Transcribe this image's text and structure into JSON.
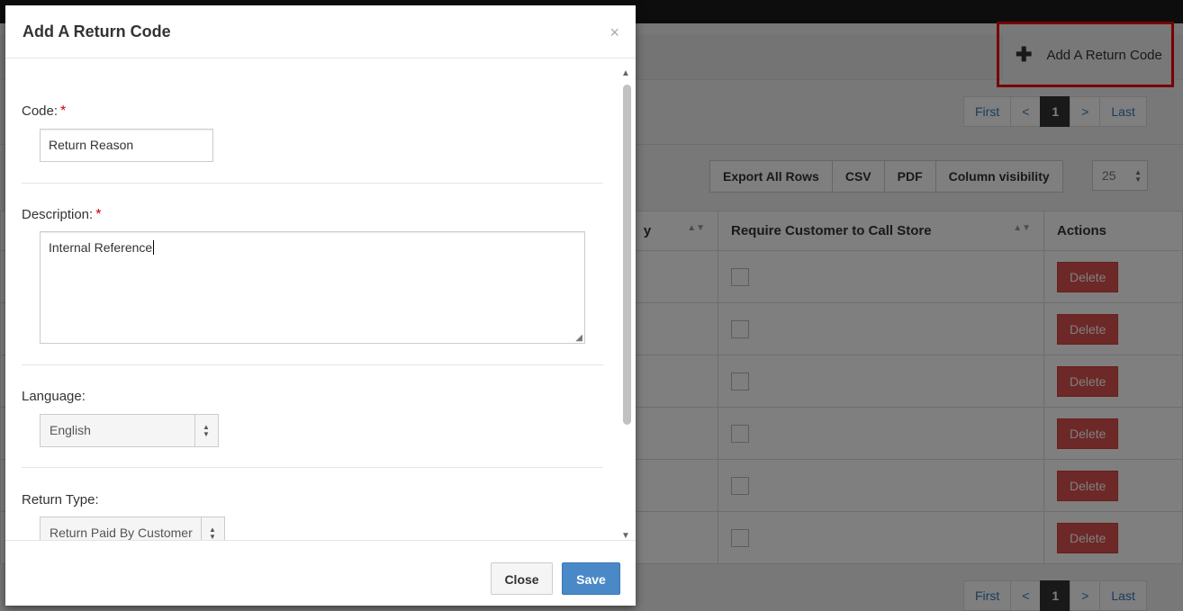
{
  "header": {
    "add_button_label": "Add A Return Code"
  },
  "pagination": {
    "first": "First",
    "prev": "<",
    "current": "1",
    "next": ">",
    "last": "Last"
  },
  "toolbar": {
    "export_all_rows": "Export All Rows",
    "csv": "CSV",
    "pdf": "PDF",
    "column_visibility": "Column visibility",
    "page_size": "25"
  },
  "table": {
    "col_partial": "y",
    "col_require_call": "Require Customer to Call Store",
    "col_actions": "Actions",
    "delete_label": "Delete",
    "row_count": 6
  },
  "modal": {
    "title": "Add A Return Code",
    "close_x": "×",
    "code_label": "Code:",
    "code_value": "Return Reason",
    "description_label": "Description:",
    "description_value": "Internal Reference",
    "language_label": "Language:",
    "language_value": "English",
    "return_type_label": "Return Type:",
    "return_type_value": "Return Paid By Customer",
    "required_mark": "*",
    "close_button": "Close",
    "save_button": "Save"
  },
  "colors": {
    "highlight": "#ee0000",
    "primary": "#337ab7",
    "danger": "#d9534f"
  }
}
